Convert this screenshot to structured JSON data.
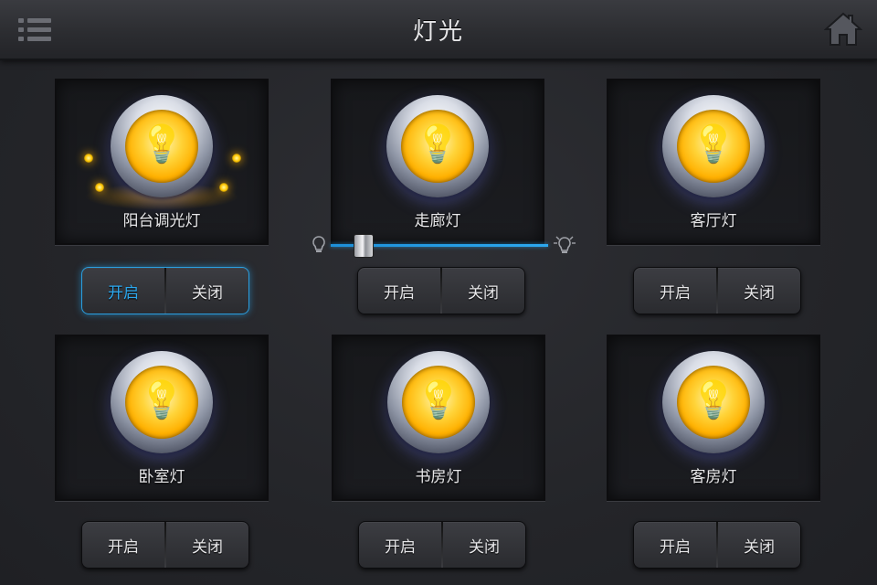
{
  "header": {
    "title": "灯光",
    "menu_icon": "list-menu-icon",
    "home_icon": "home-icon"
  },
  "colors": {
    "accent": "#2ca8ef",
    "bulb": "#ffc400"
  },
  "lights": [
    {
      "label": "阳台调光灯",
      "on_label": "开启",
      "off_label": "关闭",
      "state": "on"
    },
    {
      "label": "走廊灯",
      "on_label": "开启",
      "off_label": "关闭",
      "state": "off"
    },
    {
      "label": "客厅灯",
      "on_label": "开启",
      "off_label": "关闭",
      "state": "off"
    },
    {
      "label": "卧室灯",
      "on_label": "开启",
      "off_label": "关闭",
      "state": "off"
    },
    {
      "label": "书房灯",
      "on_label": "开启",
      "off_label": "关闭",
      "state": "off"
    },
    {
      "label": "客房灯",
      "on_label": "开启",
      "off_label": "关闭",
      "state": "off"
    }
  ],
  "dimmer": {
    "level": 0.15,
    "min_icon": "bulb-dim-icon",
    "max_icon": "bulb-bright-icon"
  }
}
